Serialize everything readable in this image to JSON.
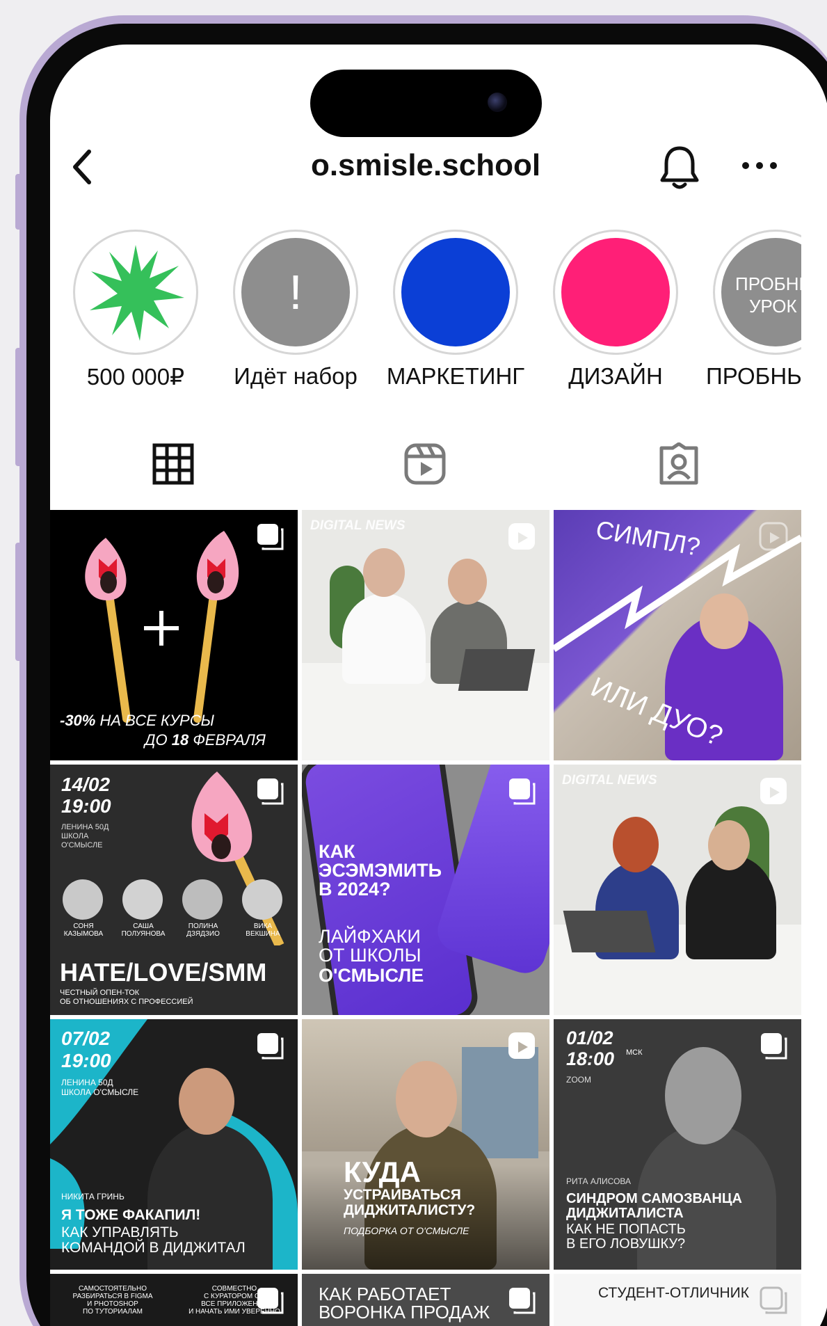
{
  "header": {
    "username": "o.smisle.school",
    "back_icon": "chevron-left-icon",
    "bell_icon": "bell-icon",
    "more_icon": "ellipsis-icon"
  },
  "highlights": [
    {
      "label": "500 000₽",
      "color": "#35c05a"
    },
    {
      "label": "Идёт набор",
      "glyph": "!",
      "color": "#8e8e8e"
    },
    {
      "label": "МАРКЕТИНГ",
      "color": "#0b3fd6"
    },
    {
      "label": "ДИЗАЙН",
      "color": "#ff1f77"
    },
    {
      "label": "ПРОБНЬ",
      "cover_text": "ПРОБНЬ\nУРОК",
      "color": "#8e8e8e"
    }
  ],
  "tabs": [
    "grid-icon",
    "reels-icon",
    "tagged-icon"
  ],
  "posts": {
    "p1": {
      "line1_bold": "-30%",
      "line1_rest": " НА ВСЕ КУРСЫ",
      "line2_pre": "ДО ",
      "line2_bold": "18",
      "line2_rest": " ФЕВРАЛЯ"
    },
    "p2": {
      "tag": "DIGITAL NEWS"
    },
    "p3": {
      "top": "СИМПЛ?",
      "bottom": "ИЛИ ДУО?"
    },
    "p4": {
      "date": "14/02",
      "time": "19:00",
      "place": "ЛЕНИНА 50Д\nШКОЛА\nО'СМЫСЛЕ",
      "speakers": [
        "СОНЯ\nКАЗЫМОВА",
        "САША\nПОЛУЯНОВА",
        "ПОЛИНА\nДЗЯДЗИО",
        "ВИКА\nВЕКШИНА"
      ],
      "headline": "HATE/LOVE/SMM",
      "sub": "ЧЕСТНЫЙ ОПЕН-ТОК\nОБ ОТНОШЕНИЯХ С ПРОФЕССИЕЙ"
    },
    "p5": {
      "title": "КАК\nЭСЭМЭМИТЬ\nВ 2024?",
      "sub": "ЛАЙФХАКИ\nОТ ШКОЛЫ",
      "brand": "О'СМЫСЛЕ"
    },
    "p6": {
      "tag": "DIGITAL NEWS"
    },
    "p7": {
      "date": "07/02",
      "time": "19:00",
      "place": "ЛЕНИНА 50Д\nШКОЛА О'СМЫСЛЕ",
      "name": "НИКИТА ГРИНЬ",
      "headline": "Я ТОЖЕ ФАКАПИЛ!",
      "sub": "КАК УПРАВЛЯТЬ\nКОМАНДОЙ В ДИДЖИТАЛ"
    },
    "p8": {
      "title": "КУДА",
      "sub": "УСТРАИВАТЬСЯ\nДИДЖИТАЛИСТУ?",
      "note": "ПОДБОРКА ОТ О'СМЫСЛЕ"
    },
    "p9": {
      "date": "01/02",
      "time": "18:00",
      "tz": "МСК",
      "platform": "ZOOM",
      "name": "РИТА АЛИСОВА",
      "headline": "СИНДРОМ САМОЗВАНЦА\nДИДЖИТАЛИСТА",
      "sub": "КАК НЕ ПОПАСТЬ\nВ ЕГО ЛОВУШКУ?"
    },
    "p10": {
      "left": "САМОСТОЯТЕЛЬНО\nРАЗБИРАТЬСЯ В FIGMA\nИ PHOTOSHOP\nПО ТУТОРИАЛАМ",
      "right": "СОВМЕСТНО\nС КУРАТОРОМ ОС\nВСЕ ПРИЛОЖЕНИЯ\nИ НАЧАТЬ ИМИ УВЕРЕННО"
    },
    "p11": {
      "title": "КАК РАБОТАЕТ\nВОРОНКА ПРОДАЖ"
    },
    "p12": {
      "title": "СТУДЕНТ-ОТЛИЧНИК"
    }
  }
}
